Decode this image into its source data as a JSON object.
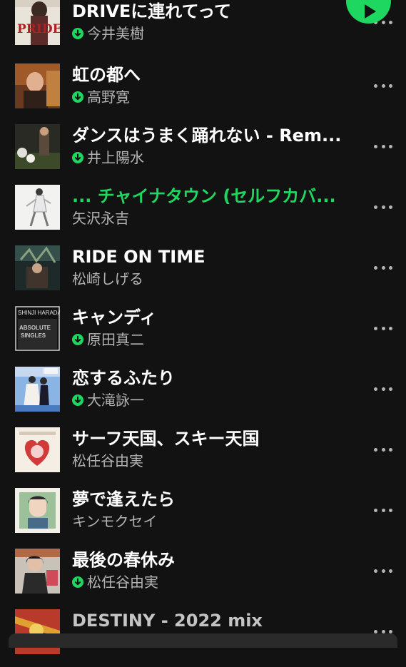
{
  "colors": {
    "background": "#121212",
    "accent": "#1ed760",
    "secondary_text": "#b3b3b3"
  },
  "play_button": {
    "icon": "play-icon"
  },
  "tracks": [
    {
      "title": "DRIVEに連れてって",
      "artist": "今井美樹",
      "downloaded": true,
      "playing": false
    },
    {
      "title": "虹の都へ",
      "artist": "高野寛",
      "downloaded": true,
      "playing": false
    },
    {
      "title": "ダンスはうまく踊れない - Rem...",
      "artist": "井上陽水",
      "downloaded": true,
      "playing": false
    },
    {
      "title": "... チャイナタウン (セルフカバ...",
      "artist": "矢沢永吉",
      "downloaded": false,
      "playing": true
    },
    {
      "title": "RIDE ON TIME",
      "artist": "松崎しげる",
      "downloaded": false,
      "playing": false
    },
    {
      "title": "キャンディ",
      "artist": "原田真二",
      "downloaded": true,
      "playing": false
    },
    {
      "title": "恋するふたり",
      "artist": "大滝詠一",
      "downloaded": true,
      "playing": false
    },
    {
      "title": "サーフ天国、スキー天国",
      "artist": "松任谷由実",
      "downloaded": false,
      "playing": false
    },
    {
      "title": "夢で逢えたら",
      "artist": "キンモクセイ",
      "downloaded": false,
      "playing": false
    },
    {
      "title": "最後の春休み",
      "artist": "松任谷由実",
      "downloaded": true,
      "playing": false
    },
    {
      "title": "DESTINY - 2022 mix",
      "artist": "",
      "downloaded": false,
      "playing": false
    }
  ],
  "covers": {
    "cover_1_text": "PRIDE",
    "cover_6_line1": "SHINJI HARADA",
    "cover_6_line2": "ABSOLUTE",
    "cover_6_line3": "SINGLES"
  }
}
